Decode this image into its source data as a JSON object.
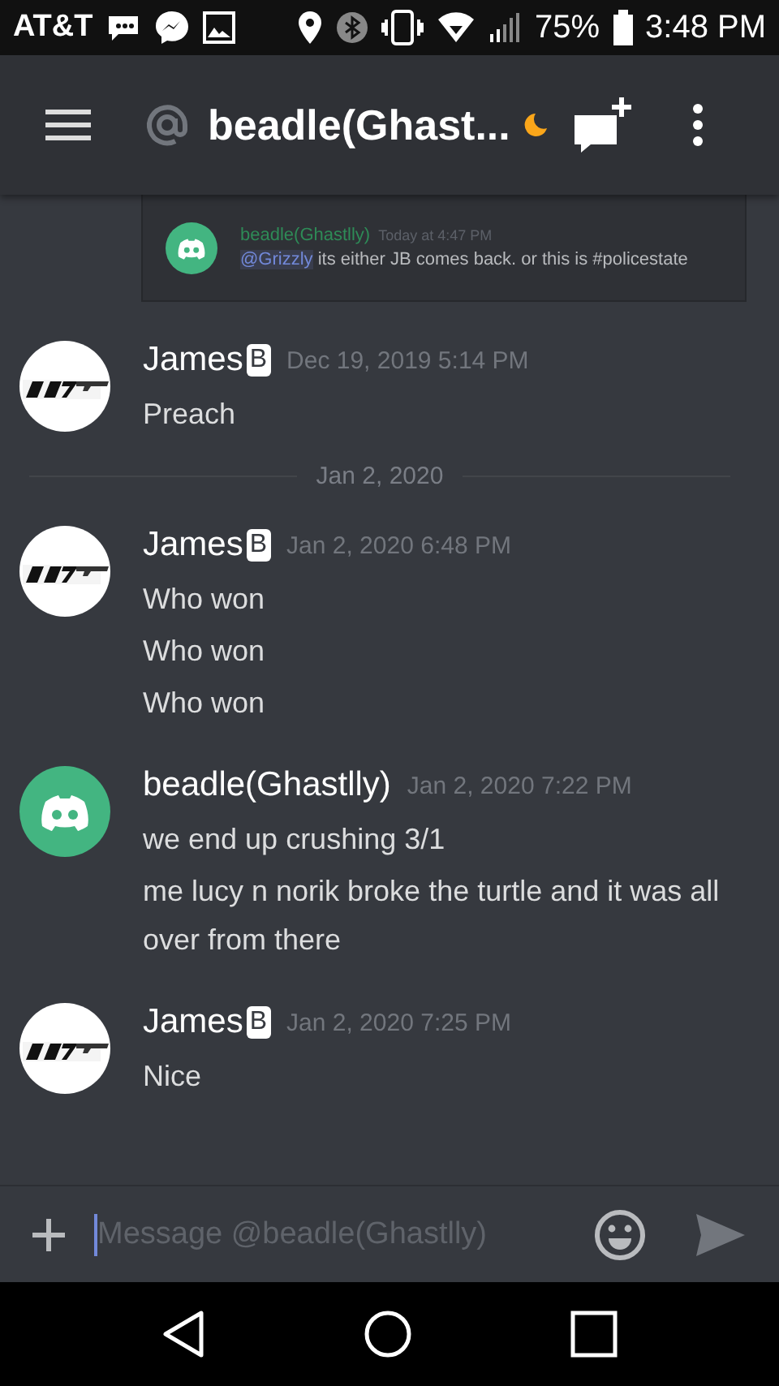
{
  "status_bar": {
    "carrier": "AT&T",
    "battery": "75%",
    "time": "3:48 PM"
  },
  "header": {
    "title": "beadle(Ghast...",
    "idle": true
  },
  "quote": {
    "author": "beadle(Ghastlly)",
    "time": "Today at 4:47 PM",
    "mention": "@Grizzly",
    "text": "its either JB comes back. or this is #policestate"
  },
  "messages": [
    {
      "kind": "message",
      "avatar": {
        "kind": "picture"
      },
      "author": "James",
      "badge": "B",
      "time": "Dec 19, 2019 5:14 PM",
      "lines": [
        "Preach"
      ]
    },
    {
      "kind": "divider",
      "label": "Jan 2, 2020"
    },
    {
      "kind": "message",
      "avatar": {
        "kind": "picture"
      },
      "author": "James",
      "badge": "B",
      "time": "Jan 2, 2020 6:48 PM",
      "lines": [
        "Who won",
        "Who won",
        "Who won"
      ]
    },
    {
      "kind": "message",
      "avatar": {
        "kind": "default_icon"
      },
      "author": "beadle(Ghastlly)",
      "time": "Jan 2, 2020 7:22 PM",
      "lines": [
        "we end up crushing 3/1",
        "me lucy n norik broke the turtle and it was all over from there"
      ]
    },
    {
      "kind": "message",
      "avatar": {
        "kind": "picture"
      },
      "author": "James",
      "badge": "B",
      "time": "Jan 2, 2020 7:25 PM",
      "lines": [
        "Nice"
      ]
    }
  ],
  "composer": {
    "placeholder": "Message @beadle(Ghastlly)"
  }
}
